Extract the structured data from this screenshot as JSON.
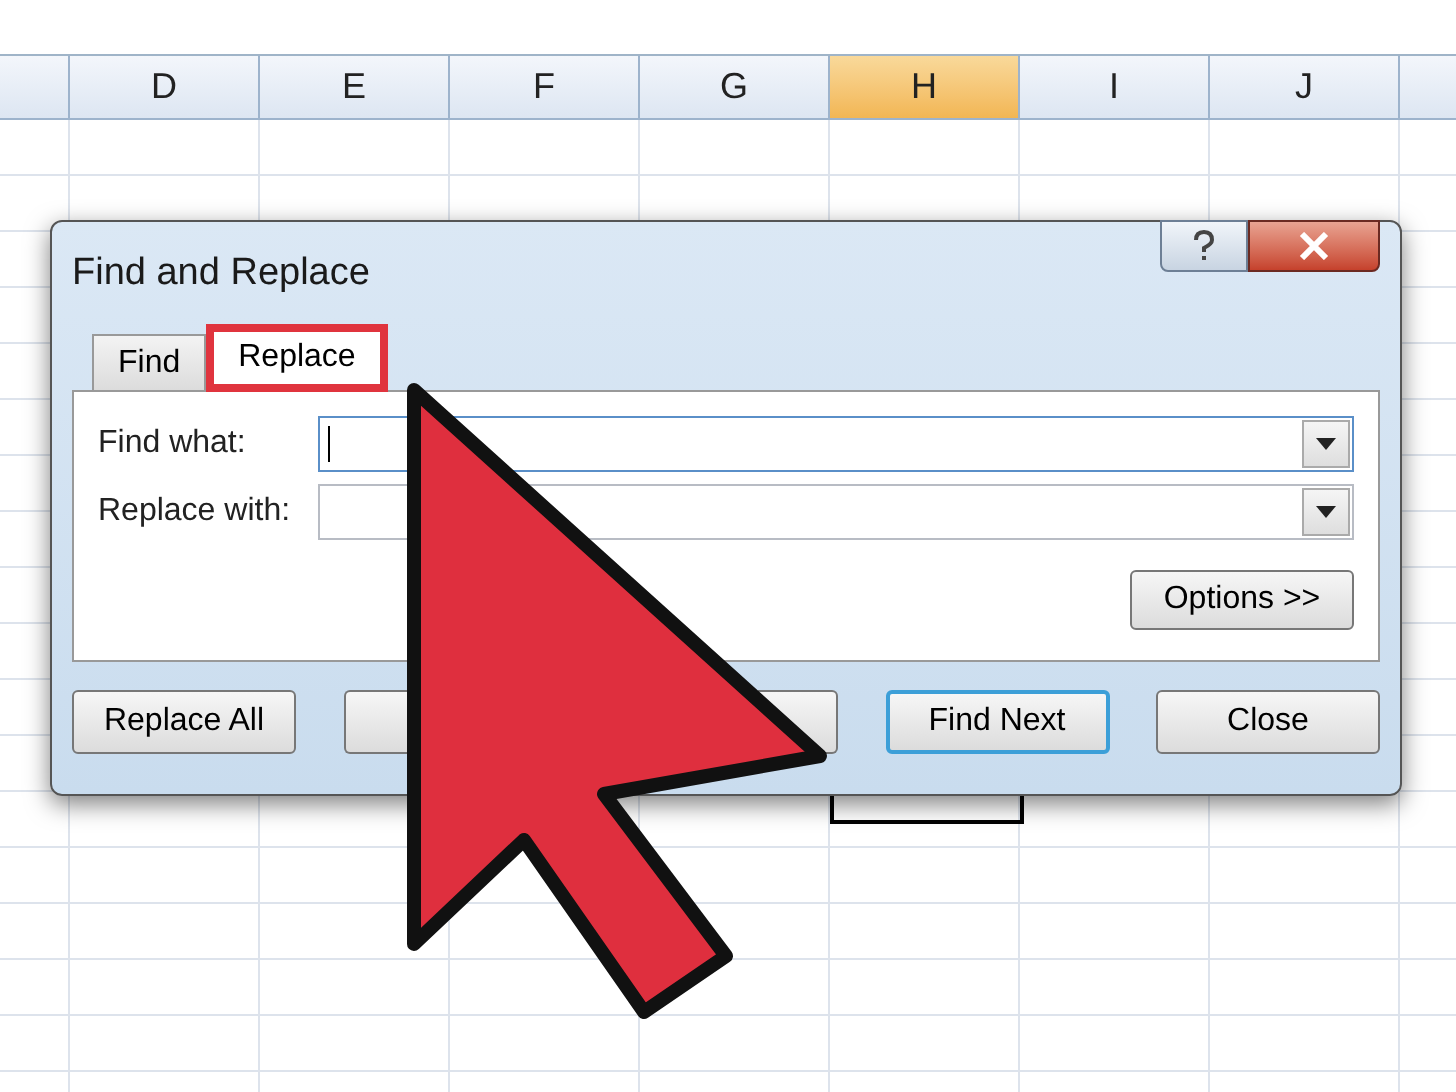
{
  "columns": [
    {
      "label": "D",
      "selected": false
    },
    {
      "label": "E",
      "selected": false
    },
    {
      "label": "F",
      "selected": false
    },
    {
      "label": "G",
      "selected": false
    },
    {
      "label": "H",
      "selected": true
    },
    {
      "label": "I",
      "selected": false
    },
    {
      "label": "J",
      "selected": false
    }
  ],
  "dialog": {
    "title": "Find and Replace",
    "tabs": [
      {
        "label": "Find",
        "selected": false,
        "highlighted": false
      },
      {
        "label": "Replace",
        "selected": true,
        "highlighted": true
      }
    ],
    "fields": [
      {
        "label": "Find what:",
        "focused": true
      },
      {
        "label": "Replace with:",
        "focused": false
      }
    ],
    "options_button": "Options >>",
    "buttons": [
      {
        "kind": "button",
        "label": "Replace All",
        "selected": false
      },
      {
        "kind": "blank"
      },
      {
        "kind": "blank"
      },
      {
        "kind": "button",
        "label": "Find Next",
        "selected": true
      },
      {
        "kind": "button",
        "label": "Close",
        "selected": false
      }
    ]
  }
}
